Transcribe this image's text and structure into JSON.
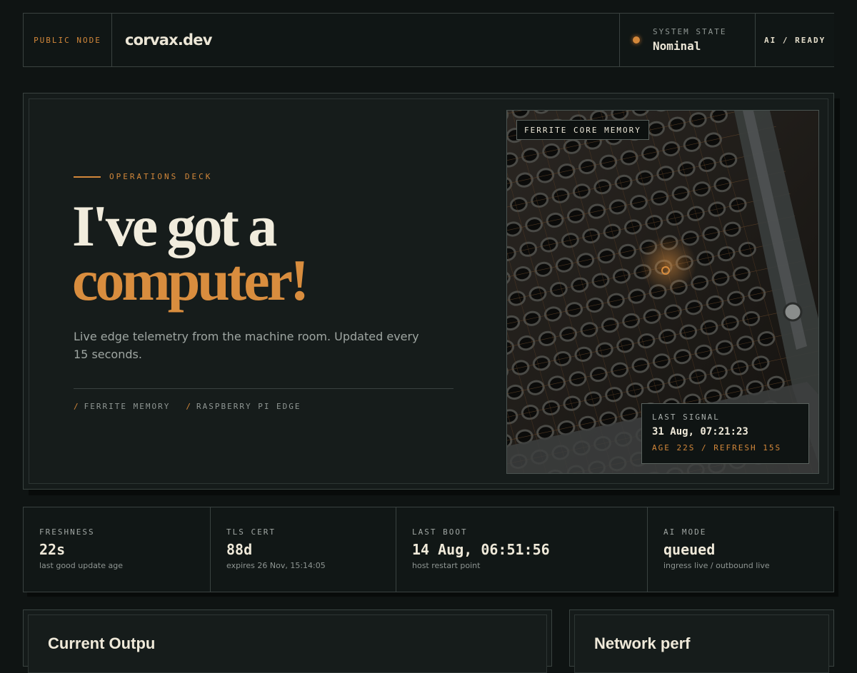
{
  "header": {
    "node_label": "PUBLIC NODE",
    "domain": "corvax.dev",
    "state_label": "SYSTEM STATE",
    "state_value": "Nominal",
    "ai_status": "AI / READY"
  },
  "hero": {
    "kicker": "OPERATIONS DECK",
    "headline_line1": "I've got a",
    "headline_line2": "computer!",
    "lede": "Live edge telemetry from the machine room. Updated every 15 seconds.",
    "tags": [
      "FERRITE MEMORY",
      "RASPBERRY PI EDGE"
    ],
    "tag_separator": "/",
    "photo_label": "FERRITE CORE MEMORY",
    "signal": {
      "label": "LAST SIGNAL",
      "value": "31 Aug, 07:21:23",
      "sub": "AGE 22S / REFRESH 15S"
    }
  },
  "stats": [
    {
      "label": "FRESHNESS",
      "value": "22s",
      "sub": "last good update age"
    },
    {
      "label": "TLS CERT",
      "value": "88d",
      "sub": "expires 26 Nov, 15:14:05"
    },
    {
      "label": "LAST BOOT",
      "value": "14 Aug, 06:51:56",
      "sub": "host restart point"
    },
    {
      "label": "AI MODE",
      "value": "queued",
      "sub": "ingress live / outbound live"
    }
  ],
  "panels": [
    {
      "title": "Current Outpu"
    },
    {
      "title": "Network perf"
    }
  ],
  "colors": {
    "accent": "#d98d3e",
    "background": "#0f1413",
    "text": "#efe9d9",
    "muted": "#8f9693"
  },
  "icons": {
    "state_indicator": "status-dot-icon"
  }
}
